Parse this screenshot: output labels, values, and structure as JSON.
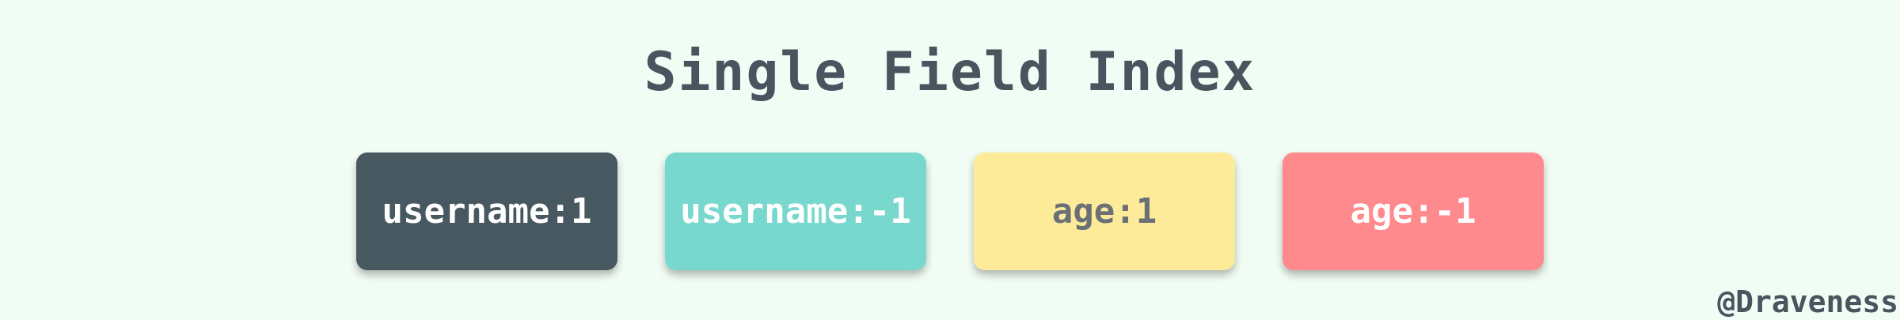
{
  "title": "Single Field Index",
  "indexes": [
    {
      "label": "username:1",
      "bg": "#485861",
      "fg": "#ffffff"
    },
    {
      "label": "username:-1",
      "bg": "#79d8cd",
      "fg": "#ffffff"
    },
    {
      "label": "age:1",
      "bg": "#feeb9a",
      "fg": "#6b7076"
    },
    {
      "label": "age:-1",
      "bg": "#ff8a8d",
      "fg": "#ffffff"
    }
  ],
  "credit": "@Draveness"
}
